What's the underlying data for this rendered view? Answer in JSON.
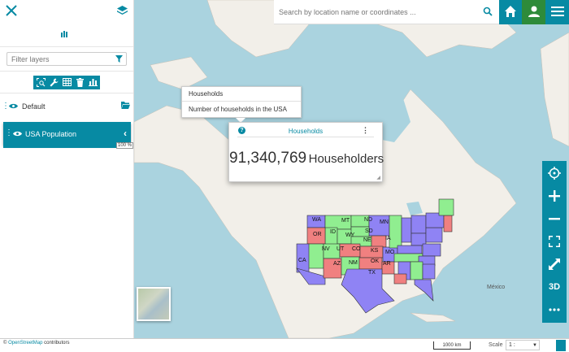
{
  "sidebar": {
    "filter_placeholder": "Filter layers",
    "group_name": "Default",
    "layer_name": "USA Population",
    "opacity_percent": 100,
    "opacity_label": "100 %"
  },
  "search": {
    "placeholder": "Search by location name or coordinates ..."
  },
  "tooltip": {
    "title": "Households",
    "description": "Number of households in the USA"
  },
  "widget": {
    "title": "Households",
    "value": "91,340,769",
    "unit": "Householders"
  },
  "map": {
    "state_labels": [
      "WA",
      "MT",
      "ND",
      "MN",
      "ID",
      "SD",
      "OR",
      "WY",
      "NE",
      "IA",
      "NV",
      "UT",
      "CO",
      "KS",
      "MO",
      "CA",
      "AZ",
      "NM",
      "OK",
      "AR",
      "TX",
      "MI",
      "IL",
      "IN",
      "OH",
      "PA",
      "NY",
      "ME",
      "VT",
      "KY",
      "TN",
      "NC",
      "SC",
      "GA",
      "AL",
      "MS",
      "LA",
      "FL",
      "VA",
      "WV"
    ],
    "country_label": "México"
  },
  "tools": {
    "threed_label": "3D"
  },
  "bottom": {
    "attribution_prefix": "©",
    "attribution_link": "OpenStreetMap",
    "attribution_suffix": "contributors",
    "scalebar_text": "1000 km",
    "scale_label": "Scale",
    "scale_value": "1 : 73957339"
  },
  "colors": {
    "accent": "#078aa3",
    "user_button": "#2e8b3a",
    "state_green": "#90ee90",
    "state_purple": "#8f83f4",
    "state_red": "#f08080"
  }
}
